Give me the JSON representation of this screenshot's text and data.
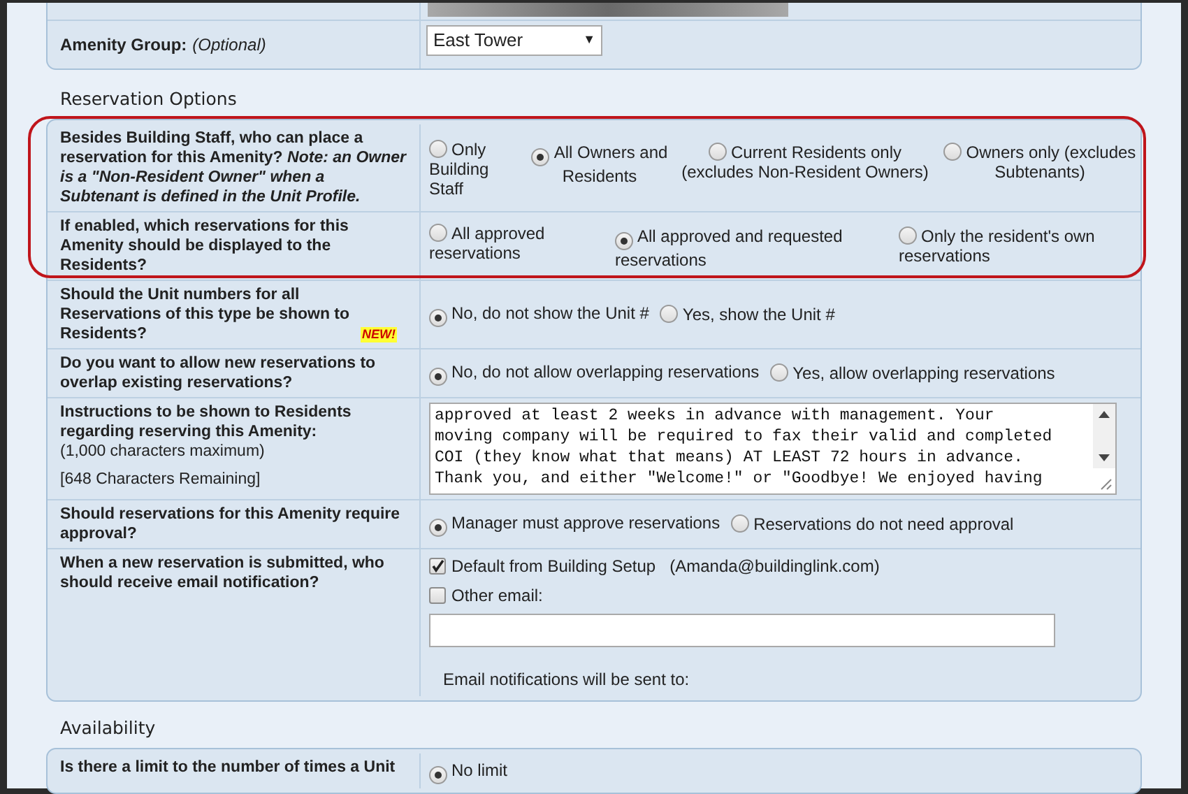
{
  "amenity_group": {
    "label": "Amenity Group:",
    "hint": "(Optional)",
    "value": "East Tower",
    "caret": "▼"
  },
  "sections": [
    {
      "title": "Reservation Options",
      "rows": [
        {
          "kind": "radio",
          "label": "Besides Building Staff, who can place a reservation for this Amenity? *Note: an Owner is a \"Non-Resident Owner\" when a Subtenant is defined in the Unit Profile.*",
          "highlighted": true,
          "options": [
            {
              "label": "Only Building Staff",
              "selected": false
            },
            {
              "label": "All Owners and Residents",
              "selected": true
            },
            {
              "label": "Current Residents only (excludes Non-Resident Owners)",
              "selected": false
            },
            {
              "label": "Owners only (excludes Subtenants)",
              "selected": false
            }
          ]
        },
        {
          "kind": "radio",
          "label": "If enabled, which reservations for this Amenity should be displayed to the Residents?",
          "highlighted": true,
          "options": [
            {
              "label": "All approved reservations",
              "selected": false
            },
            {
              "label": "All approved and requested reservations",
              "selected": true
            },
            {
              "label": "Only the resident's own reservations",
              "selected": false
            }
          ]
        },
        {
          "kind": "inline",
          "label": "Should the Unit numbers for all Reservations of this type be shown to Residents?",
          "badge": "NEW!",
          "highlighted": false,
          "options": [
            {
              "label": "No, do not show the Unit #",
              "selected": true
            },
            {
              "label": "Yes, show the Unit #",
              "selected": false
            }
          ]
        },
        {
          "kind": "inline",
          "label": "Do you want to allow new reservations to overlap existing reservations?",
          "highlighted": false,
          "options": [
            {
              "label": "No, do not allow overlapping reservations",
              "selected": true
            },
            {
              "label": "Yes, allow overlapping reservations",
              "selected": false
            }
          ]
        },
        {
          "kind": "textarea",
          "label": "Instructions to be shown to Residents regarding reserving this Amenity:",
          "highlighted": false,
          "notes": [
            "(1,000 characters maximum)",
            "[648 Characters Remaining]"
          ],
          "lines": [
            "approved at least 2 weeks in advance with management. Your",
            "moving company will be required to fax their valid and completed",
            "COI (they know what that means) AT LEAST 72 hours in advance.",
            "Thank you, and either \"Welcome!\" or \"Goodbye! We enjoyed having"
          ]
        },
        {
          "kind": "inline",
          "label": "Should reservations for this Amenity require approval?",
          "highlighted": false,
          "options": [
            {
              "label": "Manager must approve reservations",
              "selected": true
            },
            {
              "label": "Reservations do not need approval",
              "selected": false
            }
          ]
        },
        {
          "kind": "email",
          "label": "When a new reservation is submitted, who should receive email notification?",
          "highlighted": false,
          "checks": [
            {
              "label": "Default from Building Setup",
              "extra": "(Amanda@buildinglink.com)",
              "checked": true
            },
            {
              "label": "Other email:",
              "checked": false
            }
          ],
          "note": "Email notifications will be sent to:"
        }
      ]
    },
    {
      "title": "Availability",
      "rows": [
        {
          "kind": "inline",
          "label": "Is there a limit to the number of times a Unit",
          "highlighted": false,
          "options": [
            {
              "label": "No limit",
              "selected": true
            }
          ]
        }
      ]
    }
  ]
}
